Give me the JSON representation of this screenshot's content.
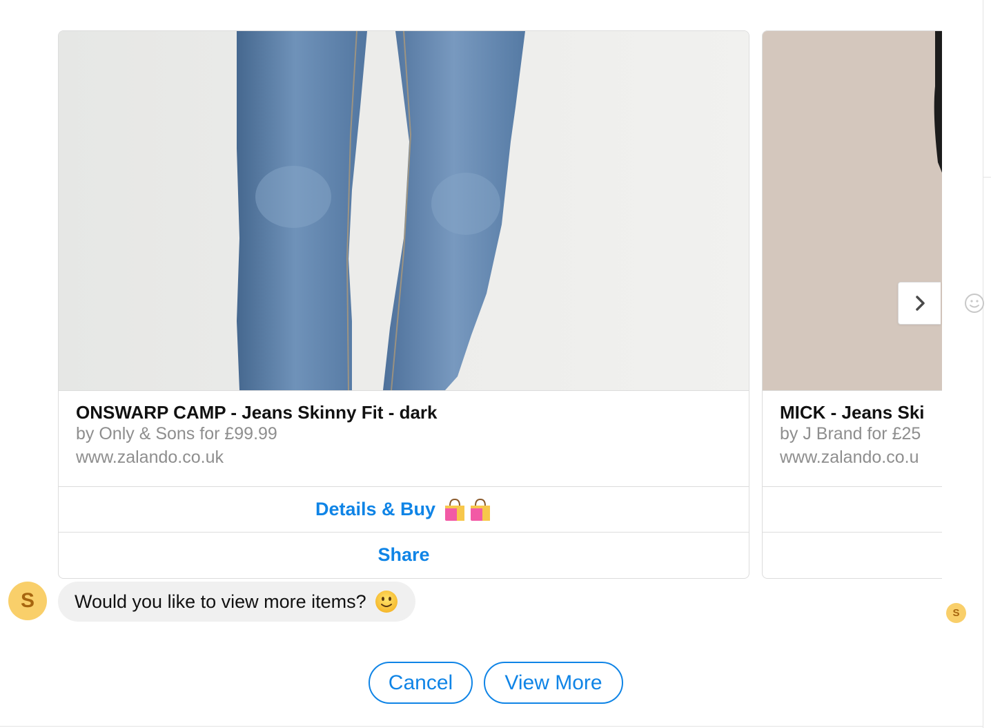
{
  "carousel": {
    "cards": [
      {
        "title": "ONSWARP CAMP - Jeans Skinny Fit - dark",
        "subtitle": "by Only & Sons for £99.99",
        "url": "www.zalando.co.uk",
        "image": "jeans-photo",
        "buttons": [
          {
            "label": "Details & Buy",
            "icon": "shopping-bags-emoji"
          },
          {
            "label": "Share"
          }
        ]
      },
      {
        "title": "MICK - Jeans Ski",
        "subtitle": "by J Brand for £25",
        "url": "www.zalando.co.u",
        "image": "jeans-photo",
        "buttons": [
          {
            "label": ""
          },
          {
            "label": ""
          }
        ]
      }
    ],
    "next_icon": "chevron-right-icon"
  },
  "message": {
    "avatar_letter": "S",
    "text": "Would you like to view more items?",
    "emoji": "slightly-smiling-face"
  },
  "read_receipt": {
    "letter": "S"
  },
  "quick_replies": [
    {
      "label": "Cancel"
    },
    {
      "label": "View More"
    }
  ],
  "colors": {
    "accent": "#0f84e6",
    "avatar": "#f9cf6a",
    "bubble": "#f0f0f0"
  }
}
